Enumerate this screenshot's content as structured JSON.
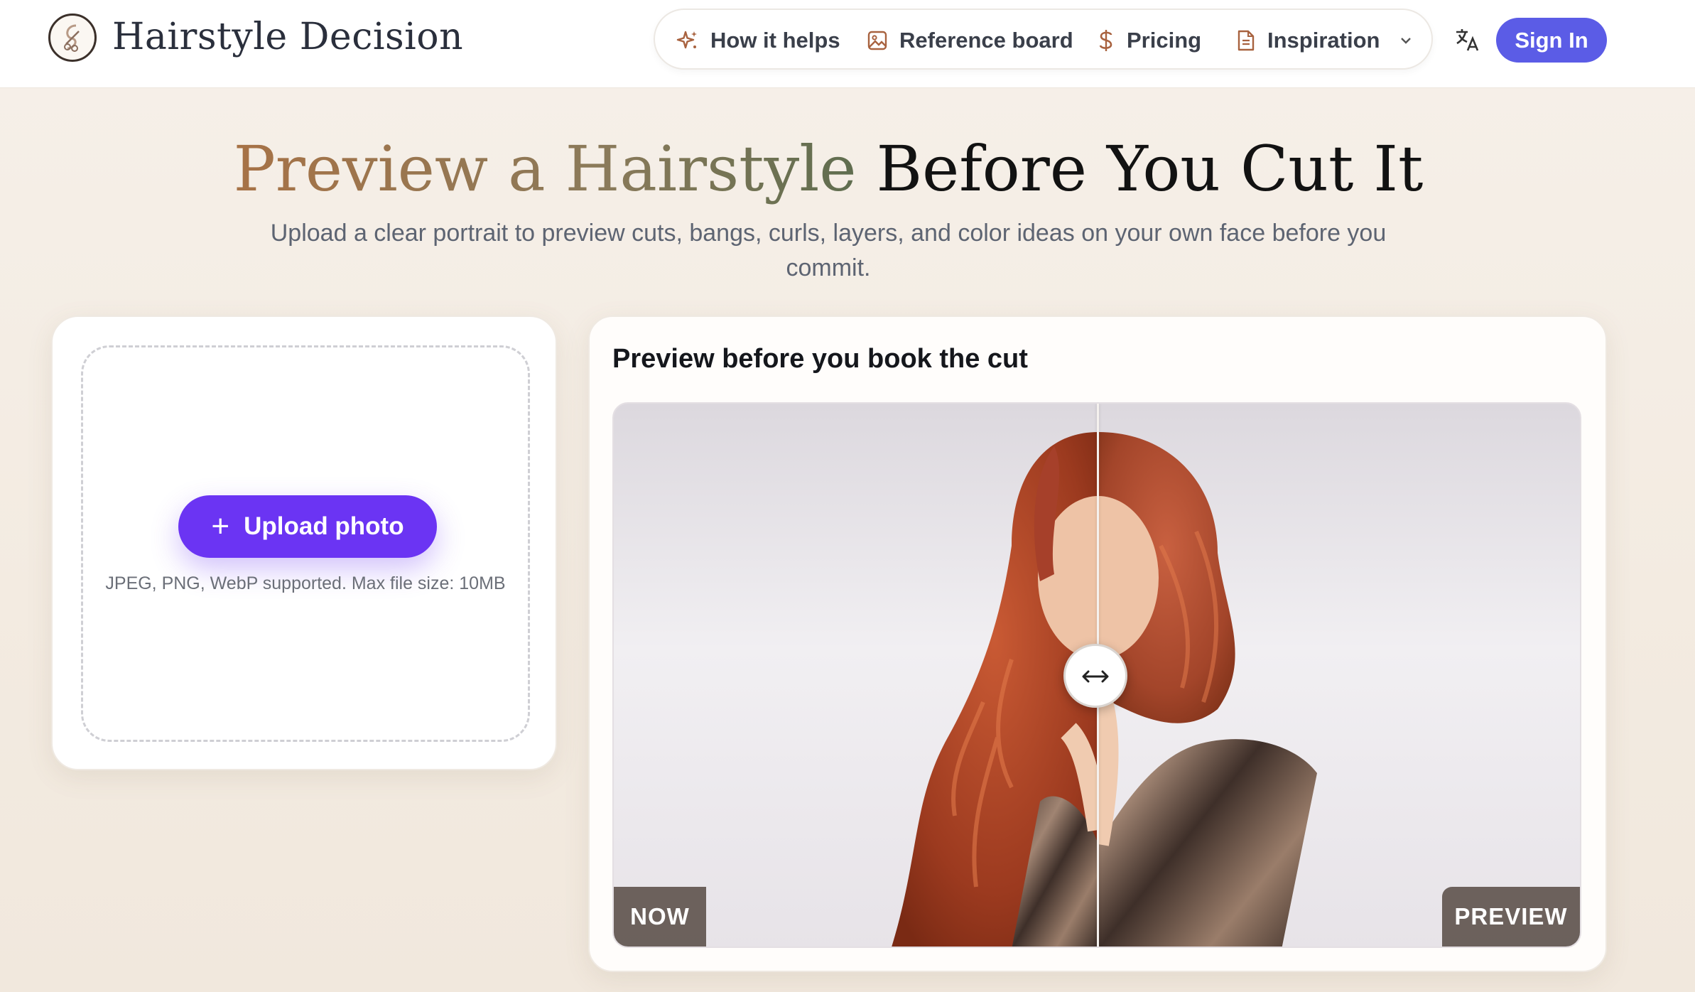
{
  "header": {
    "brand": "Hairstyle Decision",
    "nav": [
      {
        "label": "How it helps",
        "icon": "sparkles-icon"
      },
      {
        "label": "Reference board",
        "icon": "image-board-icon"
      },
      {
        "label": "Pricing",
        "icon": "dollar-icon"
      },
      {
        "label": "Inspiration",
        "icon": "document-icon"
      }
    ],
    "sign_in": "Sign In",
    "translate_icon": "translate-icon"
  },
  "hero": {
    "title_highlight": "Preview a Hairstyle",
    "title_rest": " Before You Cut It",
    "subtitle": "Upload a clear portrait to preview cuts, bangs, curls, layers, and color ideas on your own face before you commit."
  },
  "upload": {
    "button_label": "Upload photo",
    "note": "JPEG, PNG, WebP supported. Max file size: 10MB"
  },
  "preview": {
    "title": "Preview before you book the cut",
    "label_before": "NOW",
    "label_after": "PREVIEW",
    "slider_position": 0.5
  },
  "colors": {
    "accent": "#5b5ce6",
    "upload_button": "#6b34f3",
    "hair": "#b5482a"
  }
}
